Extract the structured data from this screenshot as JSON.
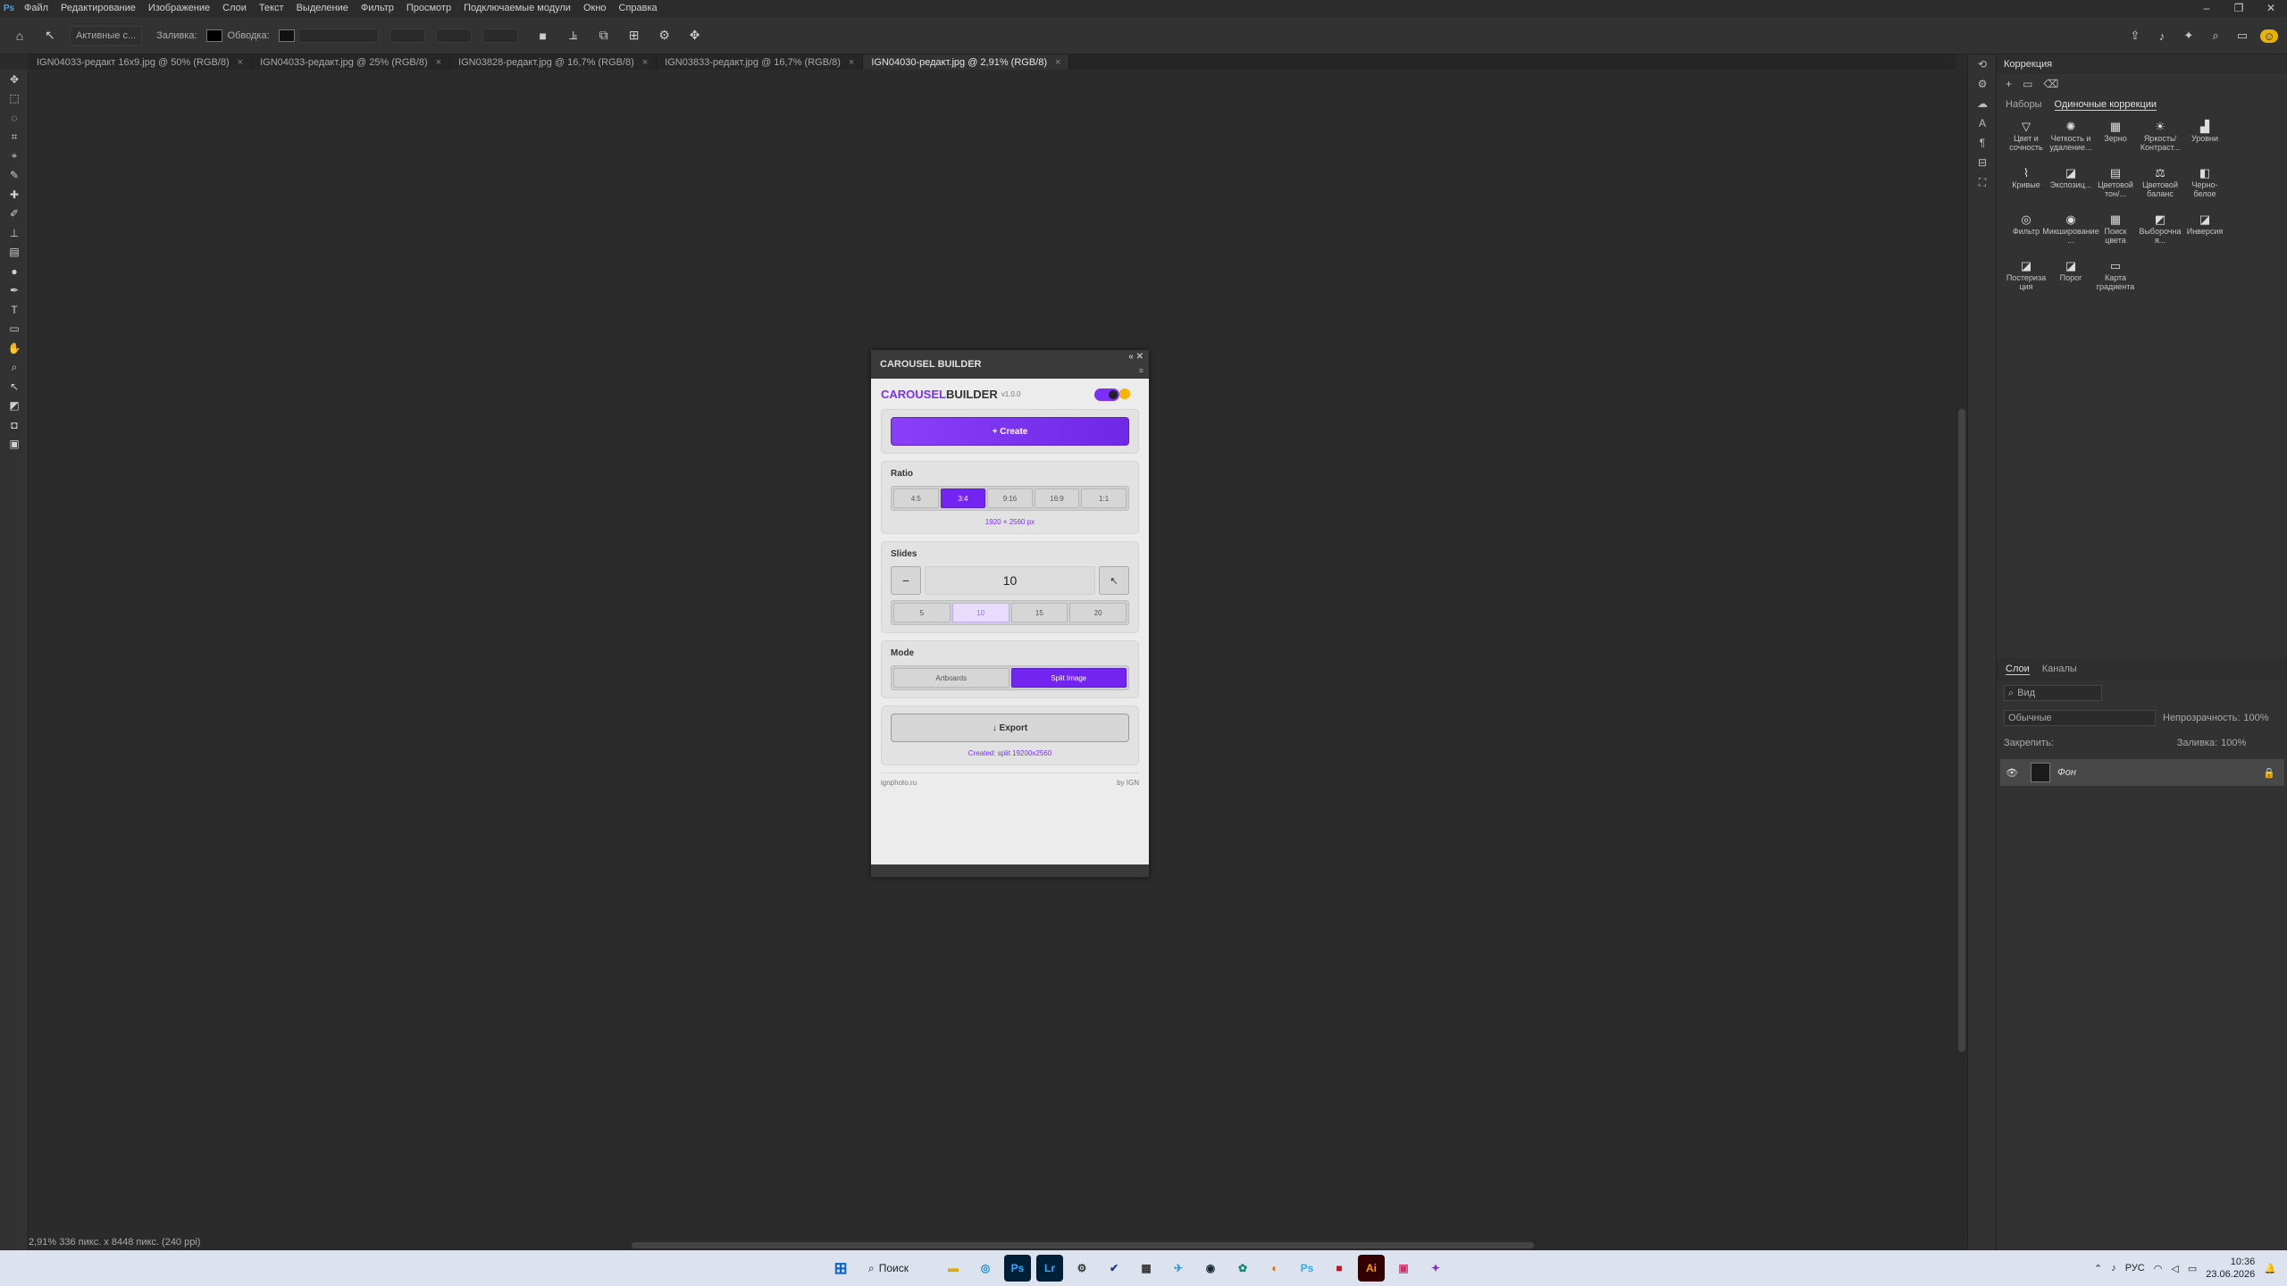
{
  "app": {
    "logo": "Ps"
  },
  "menu": [
    "Файл",
    "Редактирование",
    "Изображение",
    "Слои",
    "Текст",
    "Выделение",
    "Фильтр",
    "Просмотр",
    "Подключаемые модули",
    "Окно",
    "Справка"
  ],
  "options": {
    "select_mode": "Активные с...",
    "fill_label": "Заливка:",
    "stroke_label": "Обводка:"
  },
  "tabs": [
    {
      "title": "IGN04033-редакт 16x9.jpg @ 50% (RGB/8)"
    },
    {
      "title": "IGN04033-редакт.jpg @ 25% (RGB/8)"
    },
    {
      "title": "IGN03828-редакт.jpg @ 16,7% (RGB/8)"
    },
    {
      "title": "IGN03833-редакт.jpg @ 16,7% (RGB/8)"
    },
    {
      "title": "IGN04030-редакт.jpg @ 2,91% (RGB/8)"
    }
  ],
  "tab_close": "×",
  "status": {
    "text": "2,91%  336 пикс. x 8448 пикс. (240 ppi)"
  },
  "plugin": {
    "window_title": "CAROUSEL BUILDER",
    "brand_part1": "CAROUSEL",
    "brand_part2": " BUILDER",
    "version": "v1.0.0",
    "create_label": "+ Create",
    "ratio_label": "Ratio",
    "ratios": [
      "4:5",
      "3:4",
      "9:16",
      "16:9",
      "1:1"
    ],
    "ratio_selected": "3:4",
    "dims": "1920 × 2560 px",
    "slides_label": "Slides",
    "minus": "−",
    "slides_value": "10",
    "presets": [
      "5",
      "10",
      "15",
      "20"
    ],
    "mode_label": "Mode",
    "modes": [
      "Artboards",
      "Split Image"
    ],
    "mode_selected": "Split Image",
    "export_label": "↓ Export",
    "status_text": "Created: split 19200x2560",
    "footer_left": "ignphoto.ru",
    "footer_right": "by IGN"
  },
  "panel": {
    "title": "Коррекция",
    "tab1": "Наборы",
    "tab2": "Одиночные коррекции",
    "adjustments": [
      {
        "icon": "▽",
        "label": "Цвет и сочность"
      },
      {
        "icon": "✺",
        "label": "Четкость и удаление..."
      },
      {
        "icon": "▦",
        "label": "Зерно"
      },
      {
        "icon": "☀",
        "label": "Яркость/Контраст..."
      },
      {
        "icon": "▟",
        "label": "Уровни"
      },
      {
        "icon": "⌇",
        "label": "Кривые"
      },
      {
        "icon": "◪",
        "label": "Экспозиц..."
      },
      {
        "icon": "▤",
        "label": "Цветовой тон/..."
      },
      {
        "icon": "⚖",
        "label": "Цветовой баланс"
      },
      {
        "icon": "◧",
        "label": "Черно-белое"
      },
      {
        "icon": "◎",
        "label": "Фильтр"
      },
      {
        "icon": "◉",
        "label": "Микширование ..."
      },
      {
        "icon": "▦",
        "label": "Поиск цвета"
      },
      {
        "icon": "◩",
        "label": "Выборочна я..."
      },
      {
        "icon": "◪",
        "label": "Инверсия"
      },
      {
        "icon": "◪",
        "label": "Постериза ция"
      },
      {
        "icon": "◪",
        "label": "Порог"
      },
      {
        "icon": "▭",
        "label": "Карта градиента"
      }
    ]
  },
  "layers": {
    "tab1": "Слои",
    "tab2": "Каналы",
    "kind_placeholder": "Вид",
    "blend": "Обычные",
    "opacity_label": "Непрозрачность:",
    "opacity": "100%",
    "lock_label": "Закрепить:",
    "fill_label": "Заливка:",
    "fill": "100%",
    "layer_name": "Фон"
  },
  "taskbar": {
    "search": "Поиск",
    "lang": "РУС",
    "time": "10:36",
    "date": "23.06.2026"
  }
}
